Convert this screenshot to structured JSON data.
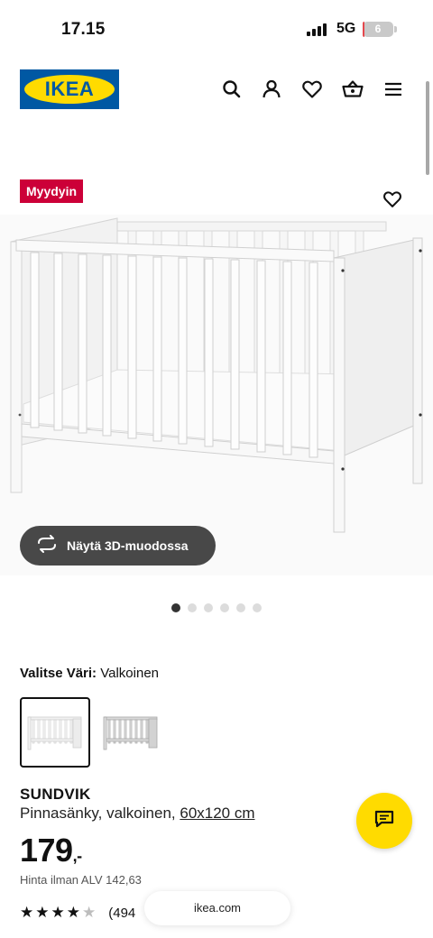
{
  "status": {
    "time": "17.15",
    "network": "5G",
    "battery": "6",
    "battery_level": 0.06
  },
  "header": {
    "logo_text": "IKEA",
    "icons": [
      "search-icon",
      "user-icon",
      "heart-icon",
      "basket-icon",
      "menu-icon"
    ]
  },
  "product": {
    "badge": "Myydyin",
    "view_3d_label": "Näytä 3D-muodossa",
    "image_count": 6,
    "active_image": 0,
    "color_label": "Valitse Väri:",
    "color_value": "Valkoinen",
    "name": "SUNDVIK",
    "description": "Pinnasänky, valkoinen,",
    "size": "60x120 cm",
    "price": "179",
    "price_suffix": ",-",
    "price_note": "Hinta ilman ALV 142,63",
    "rating": 4.5,
    "review_count": "(494"
  },
  "browser": {
    "url": "ikea.com"
  },
  "colors": {
    "ikea_blue": "#0058a3",
    "ikea_yellow": "#ffdb00",
    "badge_red": "#cc0038",
    "button_dark": "#484848"
  }
}
